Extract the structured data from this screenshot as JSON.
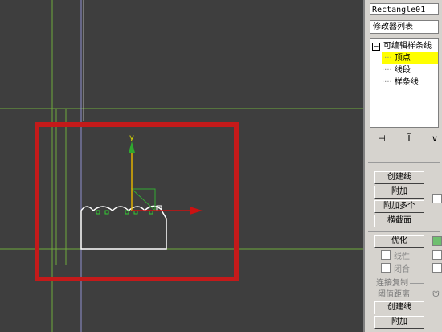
{
  "viewport": {
    "axis_y_label": "y",
    "colors": {
      "background": "#3e3e3e",
      "grid_green": "#6faa3c",
      "world_axis": "#9090d0",
      "selection_red": "#c41a1a",
      "shape_white": "#ffffff",
      "gizmo_y": "#2fa82f",
      "gizmo_x": "#cc1111",
      "gizmo_plane": "#e0b000"
    }
  },
  "panel": {
    "object_name": "Rectangle01",
    "modifier_list": "修改器列表",
    "stack": {
      "root_label": "可编辑样条线",
      "items": [
        "顶点",
        "线段",
        "样条线"
      ],
      "selected_index": 0
    },
    "toolbar_icons": [
      "pin-stack-icon",
      "show-end-result-icon",
      "make-unique-icon"
    ],
    "buttons": {
      "create_line": "创建线",
      "attach": "附加",
      "attach_multiple": "附加多个",
      "cross_section": "横截面",
      "optimize": "优化",
      "linear": "线性",
      "closed": "闭合",
      "connect_copy": "连接复制",
      "threshold": "阈值距离",
      "create_line_2": "创建线",
      "attach_2": "附加"
    }
  }
}
